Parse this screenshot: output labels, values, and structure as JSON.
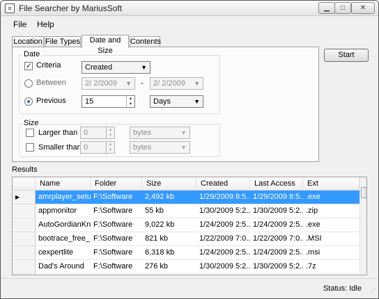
{
  "window": {
    "title": "File Searcher by MariusSoft",
    "app_icon": "≡",
    "controls": {
      "minimize": "▁",
      "maximize": "□",
      "close": "✕"
    }
  },
  "menu": [
    "File",
    "Help"
  ],
  "tabs": [
    "Location",
    "File Types",
    "Date and Size",
    "Contents"
  ],
  "active_tab": "Date and Size",
  "date": {
    "group_label": "Date",
    "criteria_label": "Criteria",
    "criteria_checked": true,
    "date_type": "Created",
    "between_label": "Between",
    "between_from": "2/  2/2009",
    "between_to": "2/  2/2009",
    "between_separator": "-",
    "previous_label": "Previous",
    "previous_value": "15",
    "previous_unit": "Days",
    "selected_mode": "Previous"
  },
  "size": {
    "group_label": "Size",
    "larger_label": "Larger than",
    "larger_value": "0",
    "larger_unit": "bytes",
    "smaller_label": "Smaller than",
    "smaller_value": "0",
    "smaller_unit": "bytes"
  },
  "start_label": "Start",
  "results": {
    "label": "Results",
    "columns": [
      "Name",
      "Folder",
      "Size",
      "Created",
      "Last Access",
      "Ext"
    ],
    "rows": [
      [
        "amrplayer_setup",
        "F:\\Software",
        "2,492 kb",
        "1/29/2009 8:5...",
        "1/29/2009 8:5...",
        ".exe"
      ],
      [
        "appmonitor",
        "F:\\Software",
        "55 kb",
        "1/30/2009 5:2...",
        "1/30/2009 5:2...",
        ".zip"
      ],
      [
        "AutoGordianKn...",
        "F:\\Software",
        "9,022 kb",
        "1/24/2009 2:5...",
        "1/24/2009 2:5...",
        ".exe"
      ],
      [
        "bootrace_free_...",
        "F:\\Software",
        "821 kb",
        "1/22/2009 7:0...",
        "1/22/2009 7:0...",
        ".MSI"
      ],
      [
        "cexpertlite",
        "F:\\Software",
        "6,318 kb",
        "1/24/2009 2:5...",
        "1/24/2009 2:5...",
        ".msi"
      ],
      [
        "Dad's Around",
        "F:\\Software",
        "276 kb",
        "1/30/2009 5:2...",
        "1/30/2009 5:2...",
        ".7z"
      ]
    ],
    "selected_row": 0,
    "row_marker": "▶"
  },
  "status": {
    "text": "Status:  Idle",
    "grip": "⋰"
  }
}
